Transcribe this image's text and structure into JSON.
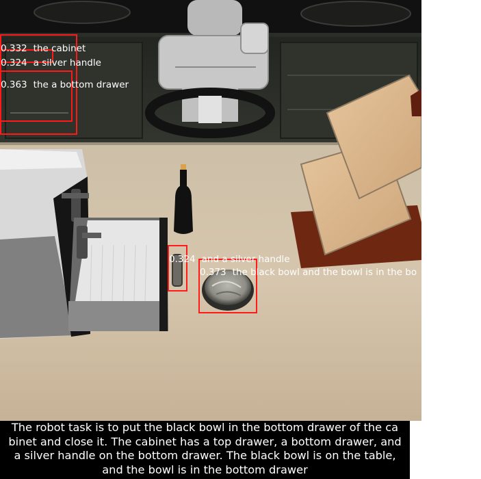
{
  "detections": [
    {
      "score": "0.332",
      "label": "the cabinet"
    },
    {
      "score": "0.324",
      "label": "a silver handle"
    },
    {
      "score": "0.363",
      "label": "the a bottom drawer"
    },
    {
      "score": "0.324",
      "label": "and a silver handle"
    },
    {
      "score": "0.373",
      "label": "the black bowl and the bowl is in the bo"
    }
  ],
  "caption": {
    "lines": [
      "The robot task is to put the black bowl in the bottom drawer of the ca",
      "binet and close it. The cabinet has a top drawer, a bottom drawer, and",
      "a silver handle on the bottom drawer. The black bowl is on the table,",
      "and the bowl is in the bottom drawer"
    ]
  },
  "colors": {
    "box": "#ff1a1a",
    "caption_bg": "#000000",
    "caption_text": "#ffffff",
    "table": "#d7c6ad",
    "wall": "#2a2d28"
  }
}
